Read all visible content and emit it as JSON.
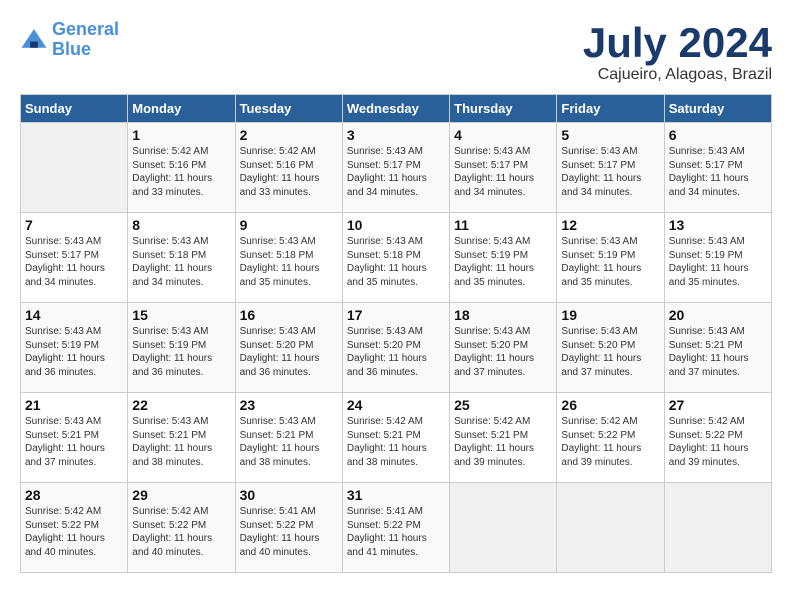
{
  "header": {
    "logo_line1": "General",
    "logo_line2": "Blue",
    "month": "July 2024",
    "location": "Cajueiro, Alagoas, Brazil"
  },
  "weekdays": [
    "Sunday",
    "Monday",
    "Tuesday",
    "Wednesday",
    "Thursday",
    "Friday",
    "Saturday"
  ],
  "weeks": [
    [
      {
        "day": "",
        "sunrise": "",
        "sunset": "",
        "daylight": ""
      },
      {
        "day": "1",
        "sunrise": "Sunrise: 5:42 AM",
        "sunset": "Sunset: 5:16 PM",
        "daylight": "Daylight: 11 hours and 33 minutes."
      },
      {
        "day": "2",
        "sunrise": "Sunrise: 5:42 AM",
        "sunset": "Sunset: 5:16 PM",
        "daylight": "Daylight: 11 hours and 33 minutes."
      },
      {
        "day": "3",
        "sunrise": "Sunrise: 5:43 AM",
        "sunset": "Sunset: 5:17 PM",
        "daylight": "Daylight: 11 hours and 34 minutes."
      },
      {
        "day": "4",
        "sunrise": "Sunrise: 5:43 AM",
        "sunset": "Sunset: 5:17 PM",
        "daylight": "Daylight: 11 hours and 34 minutes."
      },
      {
        "day": "5",
        "sunrise": "Sunrise: 5:43 AM",
        "sunset": "Sunset: 5:17 PM",
        "daylight": "Daylight: 11 hours and 34 minutes."
      },
      {
        "day": "6",
        "sunrise": "Sunrise: 5:43 AM",
        "sunset": "Sunset: 5:17 PM",
        "daylight": "Daylight: 11 hours and 34 minutes."
      }
    ],
    [
      {
        "day": "7",
        "sunrise": "Sunrise: 5:43 AM",
        "sunset": "Sunset: 5:17 PM",
        "daylight": "Daylight: 11 hours and 34 minutes."
      },
      {
        "day": "8",
        "sunrise": "Sunrise: 5:43 AM",
        "sunset": "Sunset: 5:18 PM",
        "daylight": "Daylight: 11 hours and 34 minutes."
      },
      {
        "day": "9",
        "sunrise": "Sunrise: 5:43 AM",
        "sunset": "Sunset: 5:18 PM",
        "daylight": "Daylight: 11 hours and 35 minutes."
      },
      {
        "day": "10",
        "sunrise": "Sunrise: 5:43 AM",
        "sunset": "Sunset: 5:18 PM",
        "daylight": "Daylight: 11 hours and 35 minutes."
      },
      {
        "day": "11",
        "sunrise": "Sunrise: 5:43 AM",
        "sunset": "Sunset: 5:19 PM",
        "daylight": "Daylight: 11 hours and 35 minutes."
      },
      {
        "day": "12",
        "sunrise": "Sunrise: 5:43 AM",
        "sunset": "Sunset: 5:19 PM",
        "daylight": "Daylight: 11 hours and 35 minutes."
      },
      {
        "day": "13",
        "sunrise": "Sunrise: 5:43 AM",
        "sunset": "Sunset: 5:19 PM",
        "daylight": "Daylight: 11 hours and 35 minutes."
      }
    ],
    [
      {
        "day": "14",
        "sunrise": "Sunrise: 5:43 AM",
        "sunset": "Sunset: 5:19 PM",
        "daylight": "Daylight: 11 hours and 36 minutes."
      },
      {
        "day": "15",
        "sunrise": "Sunrise: 5:43 AM",
        "sunset": "Sunset: 5:19 PM",
        "daylight": "Daylight: 11 hours and 36 minutes."
      },
      {
        "day": "16",
        "sunrise": "Sunrise: 5:43 AM",
        "sunset": "Sunset: 5:20 PM",
        "daylight": "Daylight: 11 hours and 36 minutes."
      },
      {
        "day": "17",
        "sunrise": "Sunrise: 5:43 AM",
        "sunset": "Sunset: 5:20 PM",
        "daylight": "Daylight: 11 hours and 36 minutes."
      },
      {
        "day": "18",
        "sunrise": "Sunrise: 5:43 AM",
        "sunset": "Sunset: 5:20 PM",
        "daylight": "Daylight: 11 hours and 37 minutes."
      },
      {
        "day": "19",
        "sunrise": "Sunrise: 5:43 AM",
        "sunset": "Sunset: 5:20 PM",
        "daylight": "Daylight: 11 hours and 37 minutes."
      },
      {
        "day": "20",
        "sunrise": "Sunrise: 5:43 AM",
        "sunset": "Sunset: 5:21 PM",
        "daylight": "Daylight: 11 hours and 37 minutes."
      }
    ],
    [
      {
        "day": "21",
        "sunrise": "Sunrise: 5:43 AM",
        "sunset": "Sunset: 5:21 PM",
        "daylight": "Daylight: 11 hours and 37 minutes."
      },
      {
        "day": "22",
        "sunrise": "Sunrise: 5:43 AM",
        "sunset": "Sunset: 5:21 PM",
        "daylight": "Daylight: 11 hours and 38 minutes."
      },
      {
        "day": "23",
        "sunrise": "Sunrise: 5:43 AM",
        "sunset": "Sunset: 5:21 PM",
        "daylight": "Daylight: 11 hours and 38 minutes."
      },
      {
        "day": "24",
        "sunrise": "Sunrise: 5:42 AM",
        "sunset": "Sunset: 5:21 PM",
        "daylight": "Daylight: 11 hours and 38 minutes."
      },
      {
        "day": "25",
        "sunrise": "Sunrise: 5:42 AM",
        "sunset": "Sunset: 5:21 PM",
        "daylight": "Daylight: 11 hours and 39 minutes."
      },
      {
        "day": "26",
        "sunrise": "Sunrise: 5:42 AM",
        "sunset": "Sunset: 5:22 PM",
        "daylight": "Daylight: 11 hours and 39 minutes."
      },
      {
        "day": "27",
        "sunrise": "Sunrise: 5:42 AM",
        "sunset": "Sunset: 5:22 PM",
        "daylight": "Daylight: 11 hours and 39 minutes."
      }
    ],
    [
      {
        "day": "28",
        "sunrise": "Sunrise: 5:42 AM",
        "sunset": "Sunset: 5:22 PM",
        "daylight": "Daylight: 11 hours and 40 minutes."
      },
      {
        "day": "29",
        "sunrise": "Sunrise: 5:42 AM",
        "sunset": "Sunset: 5:22 PM",
        "daylight": "Daylight: 11 hours and 40 minutes."
      },
      {
        "day": "30",
        "sunrise": "Sunrise: 5:41 AM",
        "sunset": "Sunset: 5:22 PM",
        "daylight": "Daylight: 11 hours and 40 minutes."
      },
      {
        "day": "31",
        "sunrise": "Sunrise: 5:41 AM",
        "sunset": "Sunset: 5:22 PM",
        "daylight": "Daylight: 11 hours and 41 minutes."
      },
      {
        "day": "",
        "sunrise": "",
        "sunset": "",
        "daylight": ""
      },
      {
        "day": "",
        "sunrise": "",
        "sunset": "",
        "daylight": ""
      },
      {
        "day": "",
        "sunrise": "",
        "sunset": "",
        "daylight": ""
      }
    ]
  ]
}
